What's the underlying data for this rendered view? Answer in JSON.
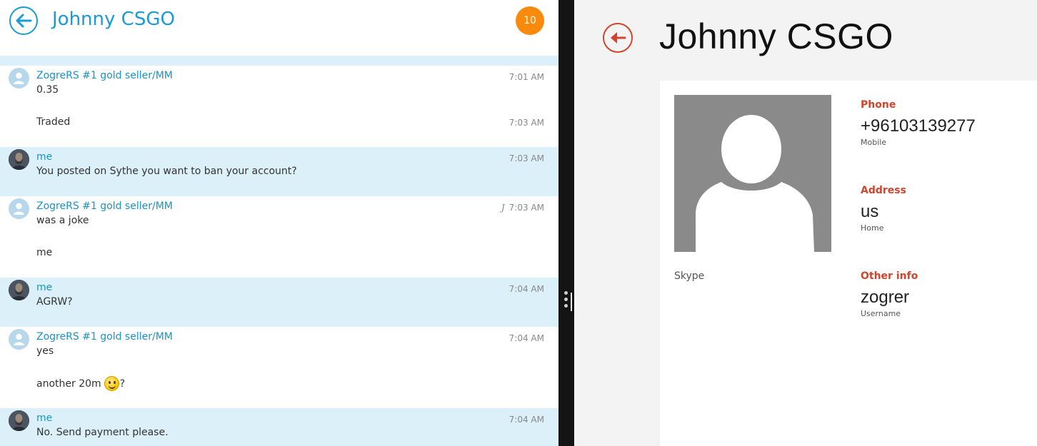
{
  "chat": {
    "title": "Johnny CSGO",
    "unread_count": "10",
    "messages": [
      {
        "sender": "ZogreRS #1 gold seller/MM",
        "time": "7:01 AM",
        "text": "0.35"
      },
      {
        "time": "7:03 AM",
        "text": "Traded"
      },
      {
        "sender": "me",
        "time": "7:03 AM",
        "text": "You posted on Sythe you want to ban your account?"
      },
      {
        "sender": "ZogreRS #1 gold seller/MM",
        "time": "7:03 AM",
        "text": "was a joke"
      },
      {
        "text": "me"
      },
      {
        "sender": "me",
        "time": "7:04 AM",
        "text": "AGRW?"
      },
      {
        "sender": "ZogreRS #1 gold seller/MM",
        "time": "7:04 AM",
        "text": "yes"
      },
      {
        "text_before_emoji": "another 20m",
        "text_after_emoji": "?"
      },
      {
        "sender": "me",
        "time": "7:04 AM",
        "text": "No. Send payment please."
      }
    ]
  },
  "contact": {
    "name": "Johnny CSGO",
    "skype_label": "Skype",
    "phone": {
      "heading": "Phone",
      "value": "+96103139277",
      "type": "Mobile"
    },
    "address": {
      "heading": "Address",
      "value": "us",
      "type": "Home"
    },
    "other": {
      "heading": "Other info",
      "value": "zogrer",
      "type": "Username"
    }
  },
  "colors": {
    "chat_accent": "#1a9ad6",
    "self_bubble": "#dcf0fa",
    "badge": "#f98a0c",
    "contact_accent": "#d2442b",
    "divider": "#141414"
  }
}
